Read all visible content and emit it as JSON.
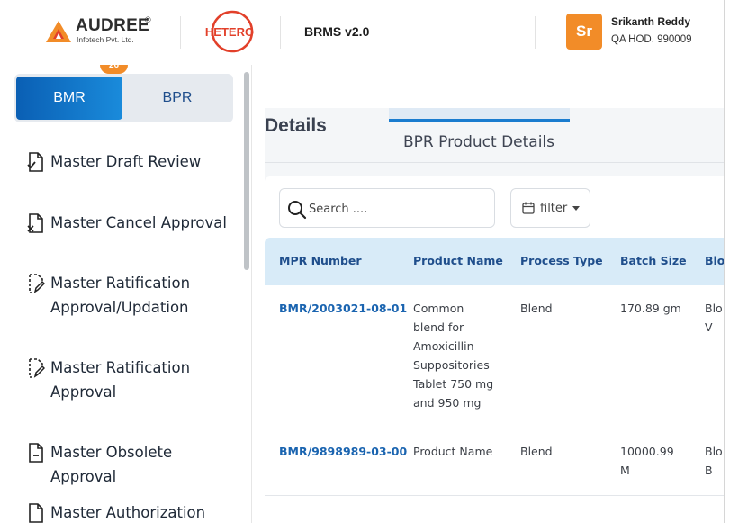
{
  "header": {
    "company_name": "AUDREE",
    "company_reg": "®",
    "company_sub": "Infotech Pvt. Ltd.",
    "partner_logo_text": "HETERO",
    "app_title": "BRMS v2.0",
    "user": {
      "initials": "Sr",
      "name": "Srikanth Reddy",
      "role": "QA HOD. 990009"
    }
  },
  "sidebar": {
    "badge_count": "26",
    "toggle": {
      "bmr_label": "BMR",
      "bpr_label": "BPR",
      "selected": "BMR"
    },
    "items": [
      {
        "label": "Master Draft Review",
        "icon": "doc-check-icon"
      },
      {
        "label": "Master Cancel Approval",
        "icon": "doc-cancel-icon"
      },
      {
        "label": "Master Ratification Approval/Updation",
        "icon": "doc-edit-icon"
      },
      {
        "label": "Master Ratification Approval",
        "icon": "doc-edit-icon"
      },
      {
        "label": "Master Obsolete Approval",
        "icon": "doc-minus-icon"
      },
      {
        "label": "Master Authorization",
        "icon": "doc-icon"
      }
    ]
  },
  "main": {
    "title": "Details",
    "tab_label": "BPR Product Details",
    "search": {
      "placeholder": "Search ...."
    },
    "filter_label": "filter",
    "table": {
      "columns": [
        "MPR Number",
        "Product Name",
        "Process Type",
        "Batch Size",
        "Blo"
      ],
      "rows": [
        {
          "mpr": "BMR/2003021-08-01",
          "product": [
            "Common",
            "blend for",
            "Amoxicillin",
            "Suppositories",
            "Tablet 750 mg",
            "and 950 mg"
          ],
          "process": "Blend",
          "batch": [
            "170.89 gm"
          ],
          "block": [
            "Blo",
            "V"
          ]
        },
        {
          "mpr": "BMR/9898989-03-00",
          "product": [
            "Product Name"
          ],
          "process": "Blend",
          "batch": [
            "10000.99",
            "M"
          ],
          "block": [
            "Blo",
            "B"
          ]
        },
        {
          "mpr": "",
          "product": [],
          "process": "",
          "batch": [],
          "block": []
        }
      ]
    }
  },
  "colors": {
    "accent_orange": "#f28c28",
    "primary_blue": "#0a5fb4",
    "table_header_bg": "#d8ebf8",
    "link_blue": "#1a64b0"
  }
}
